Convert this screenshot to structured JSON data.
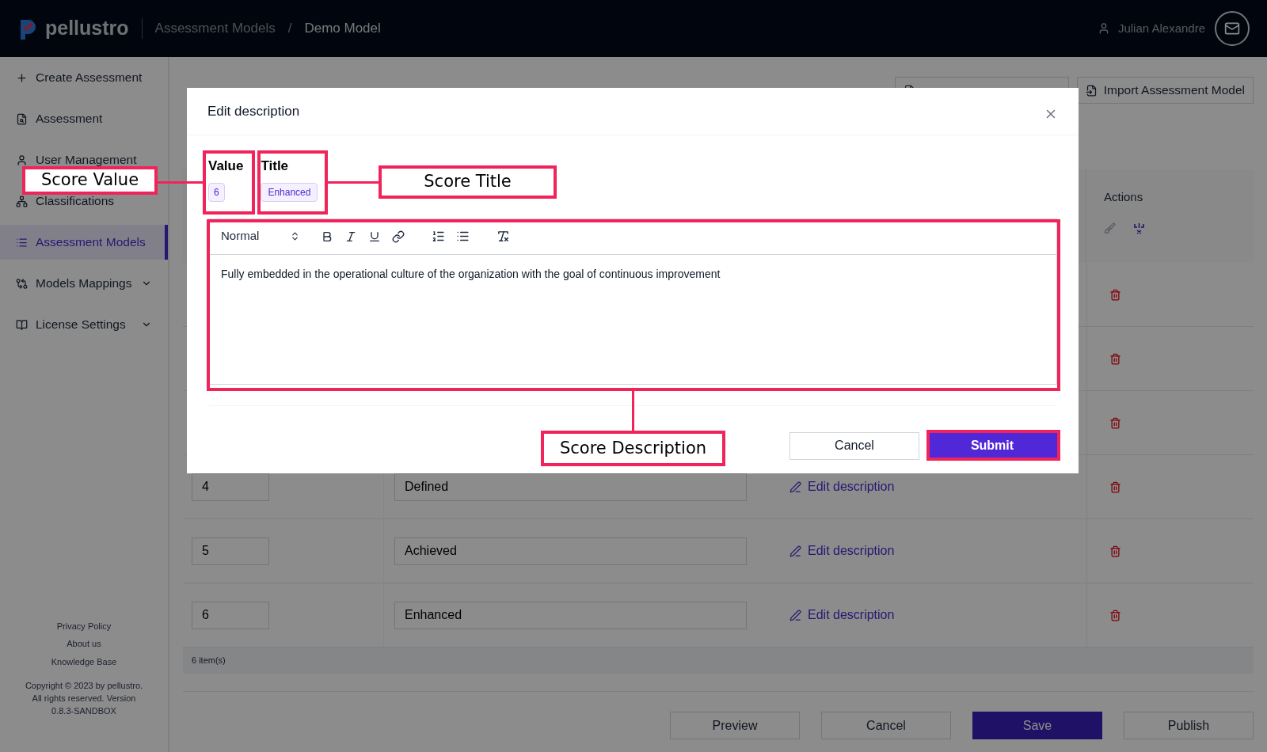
{
  "header": {
    "logo_text": "pellustro",
    "breadcrumbs": [
      "Assessment Models",
      "Demo Model"
    ],
    "separator": "/",
    "user": "Julian Alexandre"
  },
  "sidebar": {
    "items": [
      {
        "label": "Create Assessment",
        "selected": false
      },
      {
        "label": "Assessment",
        "selected": false
      },
      {
        "label": "User Management",
        "selected": false
      },
      {
        "label": "Classifications",
        "selected": false
      },
      {
        "label": "Assessment Models",
        "selected": true
      },
      {
        "label": "Models Mappings",
        "selected": false,
        "expanded": false
      },
      {
        "label": "License Settings",
        "selected": false,
        "expanded": false
      }
    ],
    "footer_links": [
      "Privacy Policy",
      "About us",
      "Knowledge Base"
    ],
    "copyright": "Copyright © 2023 by pellustro. All rights reserved. Version 0.8.3-SANDBOX"
  },
  "toolbar": {
    "import_button": "Import Assessment Model"
  },
  "table": {
    "actions_header": "Actions",
    "rows": [
      {
        "kind": "hidden"
      },
      {
        "kind": "hidden"
      },
      {
        "kind": "hidden"
      },
      {
        "kind": "row",
        "value": "4",
        "title": "Defined",
        "link": "Edit description"
      },
      {
        "kind": "row",
        "value": "5",
        "title": "Achieved",
        "link": "Edit description"
      },
      {
        "kind": "row",
        "value": "6",
        "title": "Enhanced",
        "link": "Edit description"
      }
    ],
    "footer": "6 item(s)"
  },
  "buttons": [
    {
      "label": "Preview",
      "kind": "default"
    },
    {
      "label": "Cancel",
      "kind": "default"
    },
    {
      "label": "Save",
      "kind": "primary"
    },
    {
      "label": "Publish",
      "kind": "default"
    }
  ],
  "modal": {
    "title": "Edit description",
    "value_label": "Value",
    "value": "6",
    "title_label": "Title",
    "title_value": "Enhanced",
    "editor": {
      "format": "Normal",
      "content": "Fully embedded in the operational culture of the organization with the goal of continuous improvement"
    },
    "buttons": [
      {
        "label": "Cancel",
        "kind": "default"
      },
      {
        "label": "Submit",
        "kind": "primary"
      }
    ]
  },
  "annotations": [
    {
      "text": "Score Value"
    },
    {
      "text": "Score Title"
    },
    {
      "text": "Score Description"
    }
  ]
}
